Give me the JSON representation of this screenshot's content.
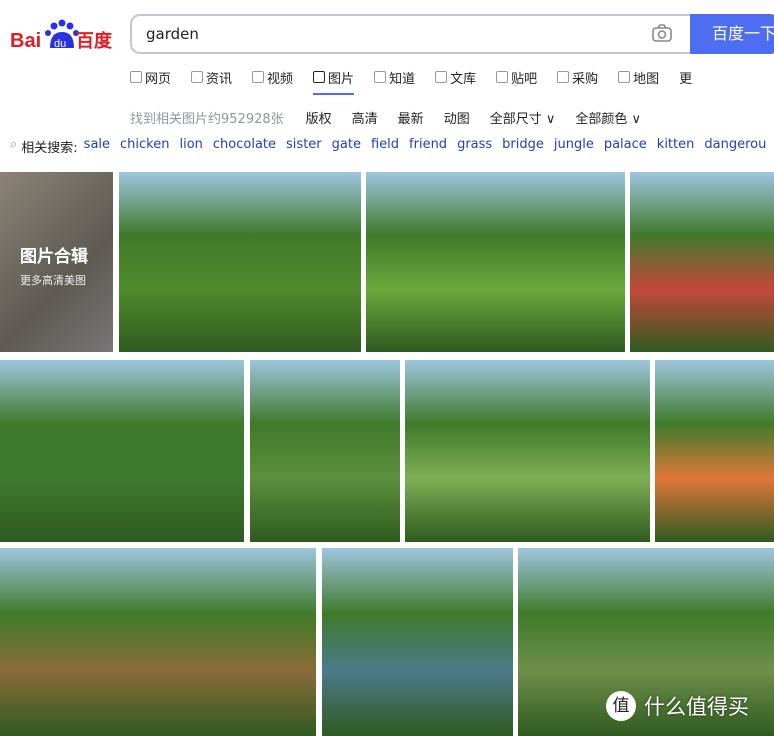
{
  "logo": {
    "text": "Bai du 百度"
  },
  "search": {
    "value": "garden",
    "button": "百度一下"
  },
  "nav": [
    {
      "label": "网页",
      "icon": "search-icon"
    },
    {
      "label": "资讯",
      "icon": "news-icon"
    },
    {
      "label": "视频",
      "icon": "video-icon"
    },
    {
      "label": "图片",
      "icon": "image-icon",
      "active": true
    },
    {
      "label": "知道",
      "icon": "question-icon"
    },
    {
      "label": "文库",
      "icon": "doc-icon"
    },
    {
      "label": "贴吧",
      "icon": "tieba-icon"
    },
    {
      "label": "采购",
      "icon": "shop-icon"
    },
    {
      "label": "地图",
      "icon": "map-icon"
    },
    {
      "label": "更",
      "icon": ""
    }
  ],
  "filters": {
    "count": "找到相关图片约952928张",
    "items": [
      "版权",
      "高清",
      "最新",
      "动图",
      "全部尺寸 ∨",
      "全部颜色 ∨"
    ]
  },
  "related": {
    "label": "相关搜索:",
    "items": [
      "sale",
      "chicken",
      "lion",
      "chocolate",
      "sister",
      "gate",
      "field",
      "friend",
      "grass",
      "bridge",
      "jungle",
      "palace",
      "kitten",
      "dangerou"
    ]
  },
  "collection": {
    "title": "图片合辑",
    "subtitle": "更多高清美图"
  },
  "watermark": {
    "badge": "值",
    "text": "什么值得买"
  },
  "colors": {
    "accent": "#4e6ef2",
    "link": "#2440b3"
  }
}
